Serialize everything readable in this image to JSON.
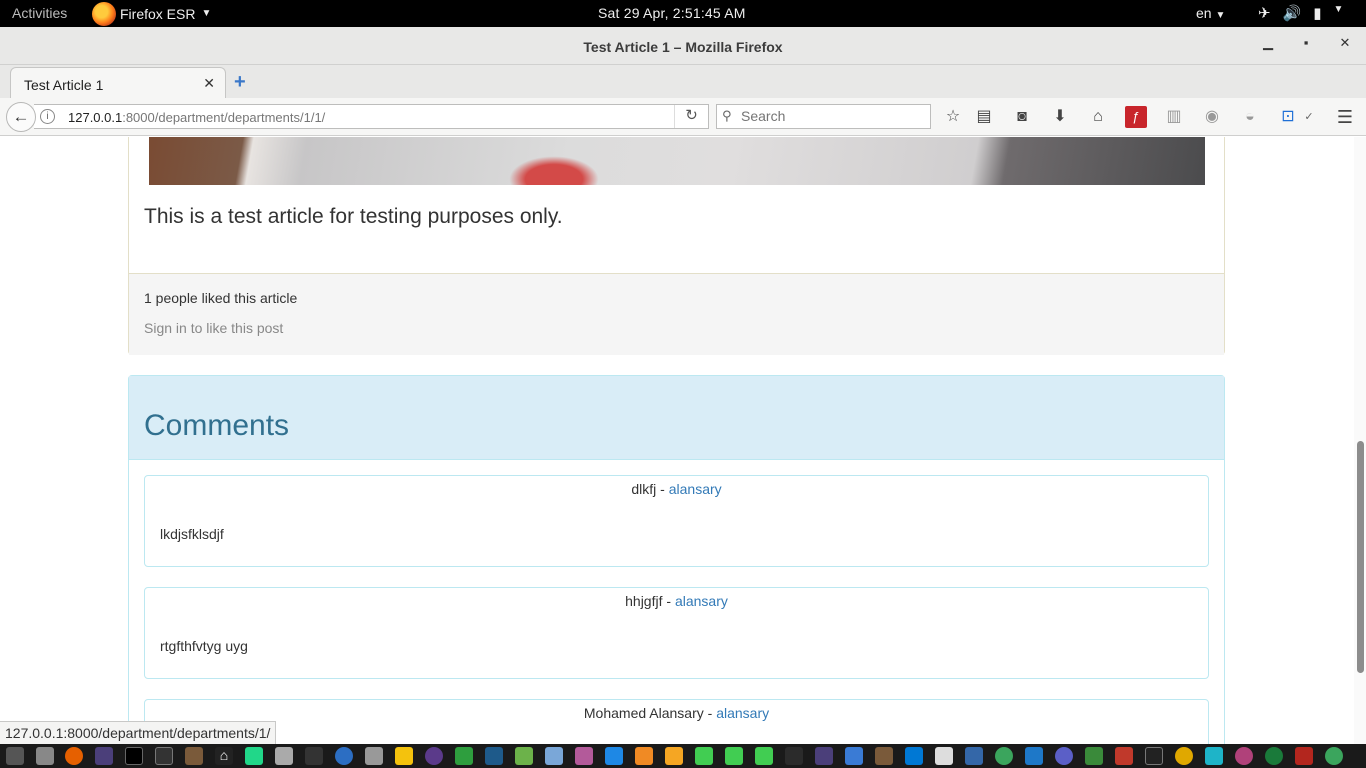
{
  "topbar": {
    "activities": "Activities",
    "app_name": "Firefox ESR",
    "clock": "Sat 29 Apr,  2:51:45 AM",
    "lang": "en"
  },
  "window": {
    "title": "Test Article 1 – Mozilla Firefox"
  },
  "tabs": [
    {
      "label": "Test Article 1"
    }
  ],
  "navbar": {
    "url_host": "127.0.0.1",
    "url_path": ":8000/department/departments/1/1/",
    "search_placeholder": "Search"
  },
  "article": {
    "body": "This is a test article for testing purposes only.",
    "likes": "1 people liked this article",
    "signin": "Sign in to like this post"
  },
  "comments": {
    "heading": "Comments",
    "items": [
      {
        "title": "dlkfj",
        "separator": " - ",
        "author": "alansary",
        "body": "lkdjsfklsdjf"
      },
      {
        "title": "hhjgfjf",
        "separator": " - ",
        "author": "alansary",
        "body": "rtgfthfvtyg uyg"
      },
      {
        "title": "Mohamed Alansary",
        "separator": " - ",
        "author": "alansary",
        "body": ""
      }
    ]
  },
  "status_bar": {
    "link": "127.0.0.1:8000/department/departments/1/"
  },
  "colors": {
    "panel_info_bg": "#d9edf7",
    "panel_info_border": "#bce8f1",
    "heading_text": "#31708f",
    "link": "#337ab7"
  },
  "icons": {
    "toolbar": [
      "bookmark-star-icon",
      "reading-list-icon",
      "pocket-icon",
      "downloads-icon",
      "home-icon",
      "flash-icon",
      "extension-icon",
      "extension-icon-2",
      "extension-icon-3",
      "extension-icon-4",
      "menu-icon"
    ]
  }
}
